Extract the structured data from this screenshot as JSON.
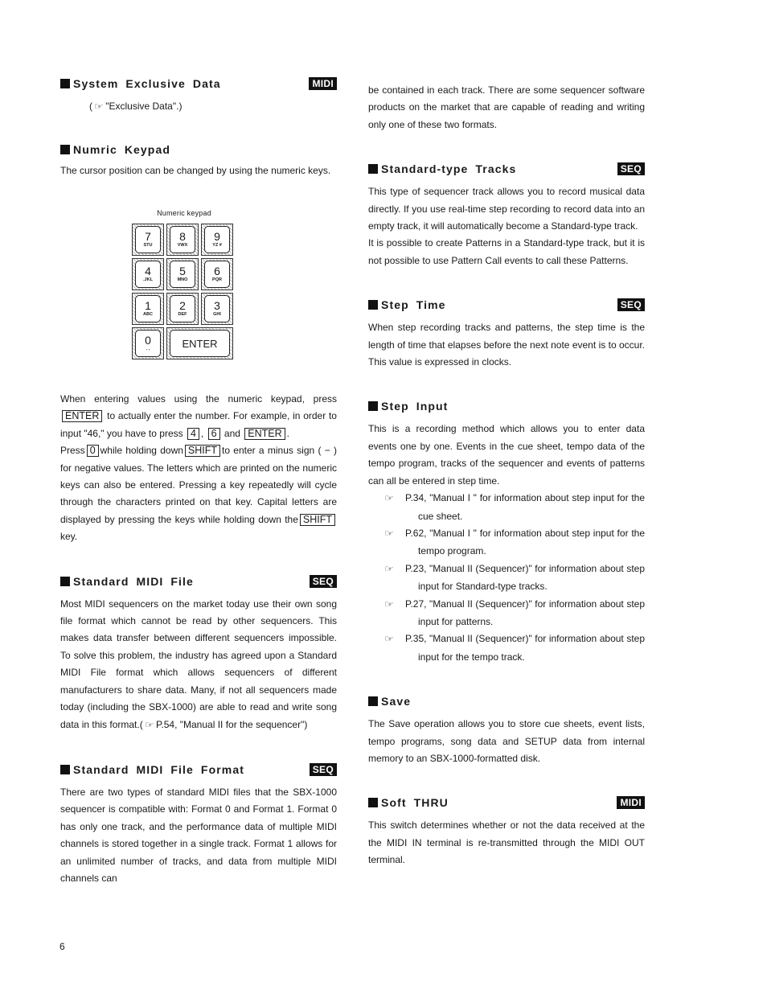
{
  "page_number": "6",
  "left": {
    "sysex": {
      "title": "System Exclusive Data",
      "badge": "MIDI",
      "ref_icon": "pointing-hand-icon",
      "ref_text": "\"Exclusive Data\".)"
    },
    "keypad": {
      "title": "Numric Keypad",
      "intro": "The cursor position can be changed by using the numeric keys.",
      "figure_caption": "Numeric keypad",
      "keys": [
        [
          {
            "num": "7",
            "letters": "STU"
          },
          {
            "num": "8",
            "letters": "VWX"
          },
          {
            "num": "9",
            "letters": "YZ #"
          }
        ],
        [
          {
            "num": "4",
            "letters": ".JKL"
          },
          {
            "num": "5",
            "letters": "MNO"
          },
          {
            "num": "6",
            "letters": "PQR"
          }
        ],
        [
          {
            "num": "1",
            "letters": "ABC"
          },
          {
            "num": "2",
            "letters": "DEF"
          },
          {
            "num": "3",
            "letters": "GHI"
          }
        ]
      ],
      "key_zero": {
        "num": "0",
        "letters": ". ,"
      },
      "key_enter": "ENTER",
      "p1_a": "When entering values using the numeric keypad, press",
      "p1_key_enter": "ENTER",
      "p1_b": "to actually enter the number. For example, in order to input \"46,\" you have to press",
      "p1_key_4": "4",
      "p1_comma": ",",
      "p1_key_6": "6",
      "p1_and": "and",
      "p1_key_enter2": "ENTER",
      "p1_end": ".",
      "p2_a": "Press",
      "p2_key_0": "0",
      "p2_b": "while holding down",
      "p2_key_shift": "SHIFT",
      "p2_c": "to enter a minus sign ( − ) for negative values. The letters which are printed on the numeric keys can also be entered. Pressing a key repeatedly will cycle through the characters printed on that key. Capital letters are displayed by pressing the keys while holding down the",
      "p2_key_shift2": "SHIFT",
      "p2_end": "key."
    },
    "smf": {
      "title": "Standard MIDI File",
      "badge": "SEQ",
      "text": "Most MIDI sequencers on the market today use their own song file format which cannot be read by other sequencers. This makes data transfer between different sequencers impossible. To solve this problem, the industry has agreed upon a Standard MIDI File format which allows sequencers of different manufacturers to share data. Many, if not all sequencers made today (including the SBX-1000) are able to read and write song data in this format.(",
      "ref_text": "P.54, \"Manual II for the sequencer\")"
    },
    "smff": {
      "title": "Standard MIDI File Format",
      "badge": "SEQ",
      "text": "There are two types of standard MIDI files that the SBX-1000 sequencer is compatible with: Format 0 and Format 1. Format 0 has only one track, and the performance data of multiple MIDI channels is stored together in a single track. Format 1 allows for an unlimited number of tracks, and data from multiple MIDI channels can"
    }
  },
  "right": {
    "continued": "be contained in each track. There are some sequencer software products on the market that are capable of reading and writing only one of these two formats.",
    "std_tracks": {
      "title": "Standard-type Tracks",
      "badge": "SEQ",
      "p1": "This type of sequencer track allows you to record musical data directly. If you use real-time step recording to record data into an empty track, it will automatically become a Standard-type track.",
      "p2": "It is possible to create Patterns in a Standard-type track, but it is not possible to use Pattern Call events to call these Patterns."
    },
    "step_time": {
      "title": "Step Time",
      "badge": "SEQ",
      "text": "When step recording tracks and patterns, the step time is the length of time that elapses before the next note event is to occur. This value is expressed in clocks."
    },
    "step_input": {
      "title": "Step Input",
      "text": "This is a recording method which allows you to enter data events one by one. Events in the cue sheet, tempo data of the tempo program, tracks of the sequencer and events of patterns can all be entered in step time.",
      "refs": [
        "P.34, \"Manual I \" for information about step input for the cue sheet.",
        "P.62, \"Manual I \" for information about step input for the tempo program.",
        "P.23, \"Manual II (Sequencer)\" for information about step input for Standard-type tracks.",
        "P.27, \"Manual II (Sequencer)\" for information about step input for patterns.",
        "P.35, \"Manual II (Sequencer)\" for information about step input for the tempo track."
      ]
    },
    "save": {
      "title": "Save",
      "text": "The Save operation allows you to store cue sheets, event lists, tempo programs, song data and SETUP data from internal memory to an SBX-1000-formatted disk."
    },
    "soft_thru": {
      "title": "Soft THRU",
      "badge": "MIDI",
      "text": "This switch determines whether or not the data received at the the MIDI IN terminal is re-transmitted through the MIDI OUT terminal."
    }
  }
}
